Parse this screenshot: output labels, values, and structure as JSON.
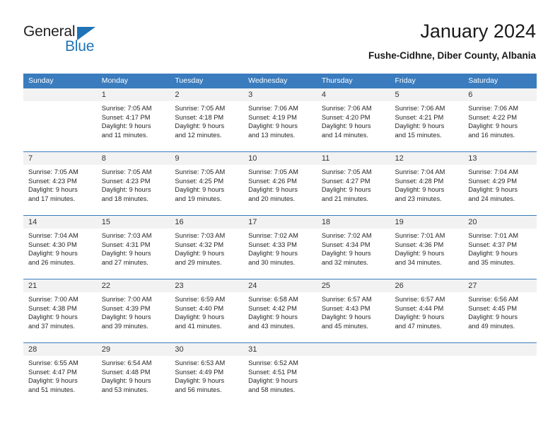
{
  "logo": {
    "word_top": "General",
    "word_bottom": "Blue",
    "triangle_icon": "logo-triangle-icon",
    "color_dark": "#221f1f",
    "color_blue": "#1f73b7"
  },
  "header": {
    "title": "January 2024",
    "subtitle": "Fushe-Cidhne, Diber County, Albania"
  },
  "theme": {
    "header_bg": "#3a7cbe",
    "date_band_bg": "#f2f2f2",
    "text": "#262626"
  },
  "calendar": {
    "weekday_headers": [
      "Sunday",
      "Monday",
      "Tuesday",
      "Wednesday",
      "Thursday",
      "Friday",
      "Saturday"
    ],
    "weeks": [
      [
        {
          "day": "",
          "sunrise": "",
          "sunset": "",
          "daylight1": "",
          "daylight2": "",
          "empty": true
        },
        {
          "day": "1",
          "sunrise": "Sunrise: 7:05 AM",
          "sunset": "Sunset: 4:17 PM",
          "daylight1": "Daylight: 9 hours",
          "daylight2": "and 11 minutes."
        },
        {
          "day": "2",
          "sunrise": "Sunrise: 7:05 AM",
          "sunset": "Sunset: 4:18 PM",
          "daylight1": "Daylight: 9 hours",
          "daylight2": "and 12 minutes."
        },
        {
          "day": "3",
          "sunrise": "Sunrise: 7:06 AM",
          "sunset": "Sunset: 4:19 PM",
          "daylight1": "Daylight: 9 hours",
          "daylight2": "and 13 minutes."
        },
        {
          "day": "4",
          "sunrise": "Sunrise: 7:06 AM",
          "sunset": "Sunset: 4:20 PM",
          "daylight1": "Daylight: 9 hours",
          "daylight2": "and 14 minutes."
        },
        {
          "day": "5",
          "sunrise": "Sunrise: 7:06 AM",
          "sunset": "Sunset: 4:21 PM",
          "daylight1": "Daylight: 9 hours",
          "daylight2": "and 15 minutes."
        },
        {
          "day": "6",
          "sunrise": "Sunrise: 7:06 AM",
          "sunset": "Sunset: 4:22 PM",
          "daylight1": "Daylight: 9 hours",
          "daylight2": "and 16 minutes."
        }
      ],
      [
        {
          "day": "7",
          "sunrise": "Sunrise: 7:05 AM",
          "sunset": "Sunset: 4:23 PM",
          "daylight1": "Daylight: 9 hours",
          "daylight2": "and 17 minutes."
        },
        {
          "day": "8",
          "sunrise": "Sunrise: 7:05 AM",
          "sunset": "Sunset: 4:23 PM",
          "daylight1": "Daylight: 9 hours",
          "daylight2": "and 18 minutes."
        },
        {
          "day": "9",
          "sunrise": "Sunrise: 7:05 AM",
          "sunset": "Sunset: 4:25 PM",
          "daylight1": "Daylight: 9 hours",
          "daylight2": "and 19 minutes."
        },
        {
          "day": "10",
          "sunrise": "Sunrise: 7:05 AM",
          "sunset": "Sunset: 4:26 PM",
          "daylight1": "Daylight: 9 hours",
          "daylight2": "and 20 minutes."
        },
        {
          "day": "11",
          "sunrise": "Sunrise: 7:05 AM",
          "sunset": "Sunset: 4:27 PM",
          "daylight1": "Daylight: 9 hours",
          "daylight2": "and 21 minutes."
        },
        {
          "day": "12",
          "sunrise": "Sunrise: 7:04 AM",
          "sunset": "Sunset: 4:28 PM",
          "daylight1": "Daylight: 9 hours",
          "daylight2": "and 23 minutes."
        },
        {
          "day": "13",
          "sunrise": "Sunrise: 7:04 AM",
          "sunset": "Sunset: 4:29 PM",
          "daylight1": "Daylight: 9 hours",
          "daylight2": "and 24 minutes."
        }
      ],
      [
        {
          "day": "14",
          "sunrise": "Sunrise: 7:04 AM",
          "sunset": "Sunset: 4:30 PM",
          "daylight1": "Daylight: 9 hours",
          "daylight2": "and 26 minutes."
        },
        {
          "day": "15",
          "sunrise": "Sunrise: 7:03 AM",
          "sunset": "Sunset: 4:31 PM",
          "daylight1": "Daylight: 9 hours",
          "daylight2": "and 27 minutes."
        },
        {
          "day": "16",
          "sunrise": "Sunrise: 7:03 AM",
          "sunset": "Sunset: 4:32 PM",
          "daylight1": "Daylight: 9 hours",
          "daylight2": "and 29 minutes."
        },
        {
          "day": "17",
          "sunrise": "Sunrise: 7:02 AM",
          "sunset": "Sunset: 4:33 PM",
          "daylight1": "Daylight: 9 hours",
          "daylight2": "and 30 minutes."
        },
        {
          "day": "18",
          "sunrise": "Sunrise: 7:02 AM",
          "sunset": "Sunset: 4:34 PM",
          "daylight1": "Daylight: 9 hours",
          "daylight2": "and 32 minutes."
        },
        {
          "day": "19",
          "sunrise": "Sunrise: 7:01 AM",
          "sunset": "Sunset: 4:36 PM",
          "daylight1": "Daylight: 9 hours",
          "daylight2": "and 34 minutes."
        },
        {
          "day": "20",
          "sunrise": "Sunrise: 7:01 AM",
          "sunset": "Sunset: 4:37 PM",
          "daylight1": "Daylight: 9 hours",
          "daylight2": "and 35 minutes."
        }
      ],
      [
        {
          "day": "21",
          "sunrise": "Sunrise: 7:00 AM",
          "sunset": "Sunset: 4:38 PM",
          "daylight1": "Daylight: 9 hours",
          "daylight2": "and 37 minutes."
        },
        {
          "day": "22",
          "sunrise": "Sunrise: 7:00 AM",
          "sunset": "Sunset: 4:39 PM",
          "daylight1": "Daylight: 9 hours",
          "daylight2": "and 39 minutes."
        },
        {
          "day": "23",
          "sunrise": "Sunrise: 6:59 AM",
          "sunset": "Sunset: 4:40 PM",
          "daylight1": "Daylight: 9 hours",
          "daylight2": "and 41 minutes."
        },
        {
          "day": "24",
          "sunrise": "Sunrise: 6:58 AM",
          "sunset": "Sunset: 4:42 PM",
          "daylight1": "Daylight: 9 hours",
          "daylight2": "and 43 minutes."
        },
        {
          "day": "25",
          "sunrise": "Sunrise: 6:57 AM",
          "sunset": "Sunset: 4:43 PM",
          "daylight1": "Daylight: 9 hours",
          "daylight2": "and 45 minutes."
        },
        {
          "day": "26",
          "sunrise": "Sunrise: 6:57 AM",
          "sunset": "Sunset: 4:44 PM",
          "daylight1": "Daylight: 9 hours",
          "daylight2": "and 47 minutes."
        },
        {
          "day": "27",
          "sunrise": "Sunrise: 6:56 AM",
          "sunset": "Sunset: 4:45 PM",
          "daylight1": "Daylight: 9 hours",
          "daylight2": "and 49 minutes."
        }
      ],
      [
        {
          "day": "28",
          "sunrise": "Sunrise: 6:55 AM",
          "sunset": "Sunset: 4:47 PM",
          "daylight1": "Daylight: 9 hours",
          "daylight2": "and 51 minutes."
        },
        {
          "day": "29",
          "sunrise": "Sunrise: 6:54 AM",
          "sunset": "Sunset: 4:48 PM",
          "daylight1": "Daylight: 9 hours",
          "daylight2": "and 53 minutes."
        },
        {
          "day": "30",
          "sunrise": "Sunrise: 6:53 AM",
          "sunset": "Sunset: 4:49 PM",
          "daylight1": "Daylight: 9 hours",
          "daylight2": "and 56 minutes."
        },
        {
          "day": "31",
          "sunrise": "Sunrise: 6:52 AM",
          "sunset": "Sunset: 4:51 PM",
          "daylight1": "Daylight: 9 hours",
          "daylight2": "and 58 minutes."
        },
        {
          "day": "",
          "sunrise": "",
          "sunset": "",
          "daylight1": "",
          "daylight2": "",
          "blank": true
        },
        {
          "day": "",
          "sunrise": "",
          "sunset": "",
          "daylight1": "",
          "daylight2": "",
          "blank": true
        },
        {
          "day": "",
          "sunrise": "",
          "sunset": "",
          "daylight1": "",
          "daylight2": "",
          "blank": true
        }
      ]
    ]
  }
}
